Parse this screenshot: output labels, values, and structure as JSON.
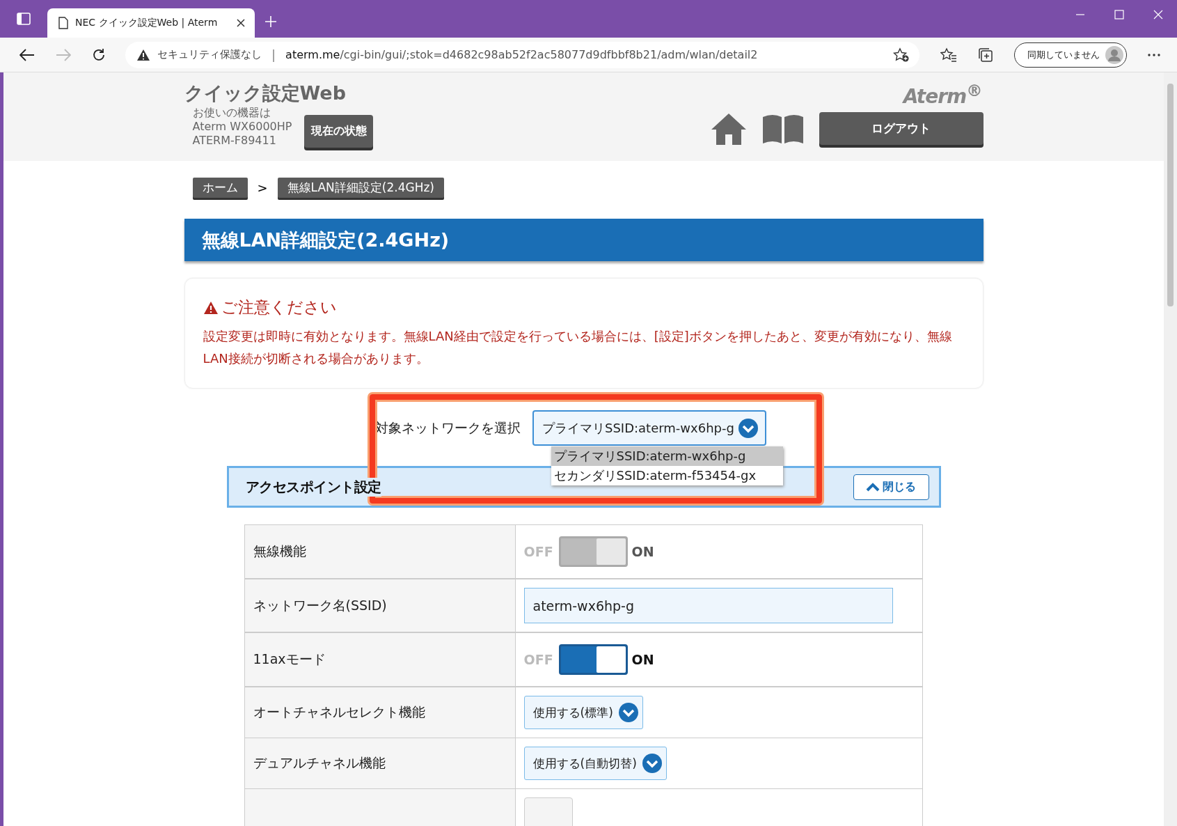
{
  "browser": {
    "tabs": [
      {
        "title": "NEC クイック設定Web | Aterm",
        "selected": true
      }
    ],
    "address": {
      "security_label": "セキュリティ保護なし",
      "separator": "|",
      "url_host": "aterm.me",
      "url_path": "/cgi-bin/gui/;stok=d4682c98ab52f2ac58077d9dfbbf8b21/adm/wlan/detail2"
    },
    "profile_button": "同期していません"
  },
  "header": {
    "title": "クイック設定Web",
    "device_lines": [
      "お使いの機器は",
      "Aterm WX6000HP",
      "ATERM-F89411"
    ],
    "status_button": "現在の状態",
    "logo": "Aterm$^{®}$",
    "logout_button": "ログアウト"
  },
  "breadcrumb": {
    "items": [
      {
        "label": "ホーム"
      },
      {
        "label": "無線LAN詳細設定(2.4GHz)"
      }
    ],
    "separator": ">"
  },
  "page_title": "無線LAN詳細設定(2.4GHz)",
  "notice": {
    "title": "ご注意ください",
    "body": "設定変更は即時に有効となります。無線LAN経由で設定を行っている場合には、[設定]ボタンを押したあと、変更が有効になり、無線LAN接続が切断される場合があります。"
  },
  "network_select": {
    "label": "対象ネットワークを選択",
    "value": "プライマリSSID:aterm-wx6hp-g",
    "expanded": true,
    "options": [
      {
        "label": "プライマリSSID:aterm-wx6hp-g",
        "selected": true
      },
      {
        "label": "セカンダリSSID:aterm-f53454-gx",
        "selected": false
      }
    ]
  },
  "section": {
    "title": "アクセスポイント設定",
    "close_button": "閉じる"
  },
  "settings": [
    {
      "label": "無線機能",
      "kind": "toggle",
      "off_label": "OFF",
      "on_label": "ON",
      "on": true,
      "disabled": true
    },
    {
      "label": "ネットワーク名(SSID)",
      "kind": "text",
      "value": "aterm-wx6hp-g"
    },
    {
      "label": "11axモード",
      "kind": "toggle",
      "off_label": "OFF",
      "on_label": "ON",
      "on": true,
      "disabled": false
    },
    {
      "label": "オートチャネルセレクト機能",
      "kind": "select",
      "value": "使用する(標準)"
    },
    {
      "label": "デュアルチャネル機能",
      "kind": "select",
      "value": "使用する(自動切替)"
    },
    {
      "kind": "partial"
    }
  ]
}
